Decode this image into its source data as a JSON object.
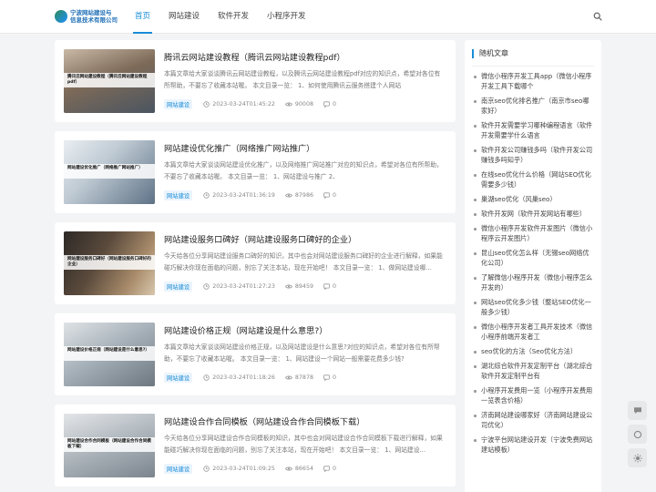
{
  "site": {
    "logo_line1": "宁波网站建设与",
    "logo_line2": "信息技术有限公司"
  },
  "nav": [
    {
      "label": "首页",
      "active": true
    },
    {
      "label": "网站建设",
      "active": false
    },
    {
      "label": "软件开发",
      "active": false
    },
    {
      "label": "小程序开发",
      "active": false
    }
  ],
  "posts": [
    {
      "title": "腾讯云网站建设教程（腾讯云网站建设教程pdf）",
      "thumb_caption": "腾讯云网站建设教程（腾讯云网站建设教程pdf）",
      "excerpt": "本篇文章给大家谈谈腾讯云网站建设教程，以及腾讯云网站建设教程pdf对应的知识点，希望对各位有所帮助，不要忘了收藏本站喔。 本文目录一览： 1、如何使用腾讯云服务搭建个人网站",
      "tag": "网站建设",
      "time": "2023-03-24T01:45:22",
      "views": "90008",
      "comments": "0"
    },
    {
      "title": "网站建设优化推广（网络推广网站推广）",
      "thumb_caption": "网站建设优化推广（网络推广网站推广）",
      "excerpt": "本篇文章给大家谈谈网站建设优化推广，以及网络推广网站推广对应的知识点，希望对各位有所帮助，不要忘了收藏本站喔。 本文目录一览： 1、网站建设与推广 2、",
      "tag": "网站建设",
      "time": "2023-03-24T01:36:19",
      "views": "87986",
      "comments": "0"
    },
    {
      "title": "网站建设服务口碑好（网站建设服务口碑好的企业）",
      "thumb_caption": "网站建设服务口碑好（网站建设服务口碑好的企业）",
      "excerpt": "今天给各位分享网站建设服务口碑好的知识，其中也会对网站建设服务口碑好的企业进行解释，如果能碰巧解决你现在面临的问题，别忘了关注本站，现在开始吧！ 本文目录一览： 1、做网站建设哪...",
      "tag": "网站建设",
      "time": "2023-03-24T01:27:23",
      "views": "89459",
      "comments": "0"
    },
    {
      "title": "网站建设价格正规（网站建设是什么意思?）",
      "thumb_caption": "网站建设价格正规（网站建设是什么意思?）",
      "excerpt": "本篇文章给大家谈谈网站建设价格正规，以及网站建设是什么意思?对应的知识点，希望对各位有所帮助，不要忘了收藏本站喔。 本文目录一览： 1、网站建设一个网站一般需要花费多少钱?",
      "tag": "网站建设",
      "time": "2023-03-24T01:18:26",
      "views": "87878",
      "comments": "0"
    },
    {
      "title": "网站建设合作合同模板（网站建设合作合同模板下载）",
      "thumb_caption": "网站建设合作合同模板（网站建设合作合同模板下载）",
      "excerpt": "今天给各位分享网站建设合作合同模板的知识，其中也会对网站建设合作合同模板下载进行解释，如果能碰巧解决你现在面临的问题，别忘了关注本站，现在开始吧！ 本文目录一览： 1、网站建设...",
      "tag": "网站建设",
      "time": "2023-03-24T01:09:25",
      "views": "86654",
      "comments": "0"
    }
  ],
  "sidebar": {
    "title": "随机文章",
    "items": [
      "微信小程序开发工具app（微信小程序开发工具下载哪个",
      "南京seo优化排名推广（南京市seo哪家好）",
      "软件开发需要学习哪种编程语言（软件开发需要学什么语言",
      "软件开发公司赚钱多吗（软件开发公司赚钱多吗知乎）",
      "在线seo优化什么价格（网站SEO优化需要多少钱）",
      "巢湖seo优化（风巢seo）",
      "软件开发网（软件开发网站有哪些）",
      "微信小程序开发软件开发图片（微信小程序云开发图片）",
      "昆山seo优化怎么样（无锡seo网络优化公司）",
      "了解微信小程序开发（微信小程序怎么开发的）",
      "网站seo优化多少钱（整站SEO优化一般多少钱）",
      "微信小程序开发者工具开发技术（微信小程序前端开发者工",
      "seo优化的方法（Seo优化方法）",
      "湖北综合软件开发定制平台（湖北综合软件开发定制平台有",
      "小程序开发费用一览（小程序开发费用一览表含价格）",
      "济南网站建设哪家好（济南网站建设公司优化）",
      "宁波平台网站建设开发（宁波免费网站建站模板）"
    ]
  }
}
